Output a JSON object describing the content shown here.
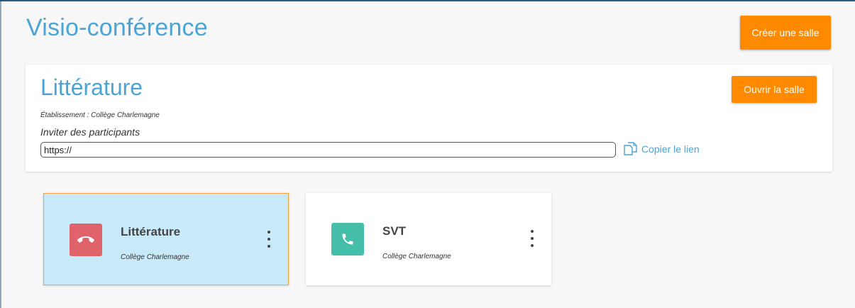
{
  "header": {
    "title": "Visio-conférence",
    "create_room_label": "Créer une salle"
  },
  "room_panel": {
    "title": "Littérature",
    "school_label": "Établissement : Collège Charlemagne",
    "invite_label": "Inviter des participants",
    "link_value": "https://",
    "copy_link_label": "Copier le lien",
    "open_room_label": "Ouvrir la salle"
  },
  "rooms": [
    {
      "title": "Littérature",
      "school": "Collège Charlemagne",
      "icon": "hang-up-phone-icon",
      "color": "#e0636b",
      "selected": true
    },
    {
      "title": "SVT",
      "school": "Collège Charlemagne",
      "icon": "phone-icon",
      "color": "#45bfaa",
      "selected": false
    }
  ],
  "colors": {
    "accent": "#ff8a00",
    "title_blue": "#4aa4d6",
    "selected_card_bg": "#c8eaf8"
  }
}
